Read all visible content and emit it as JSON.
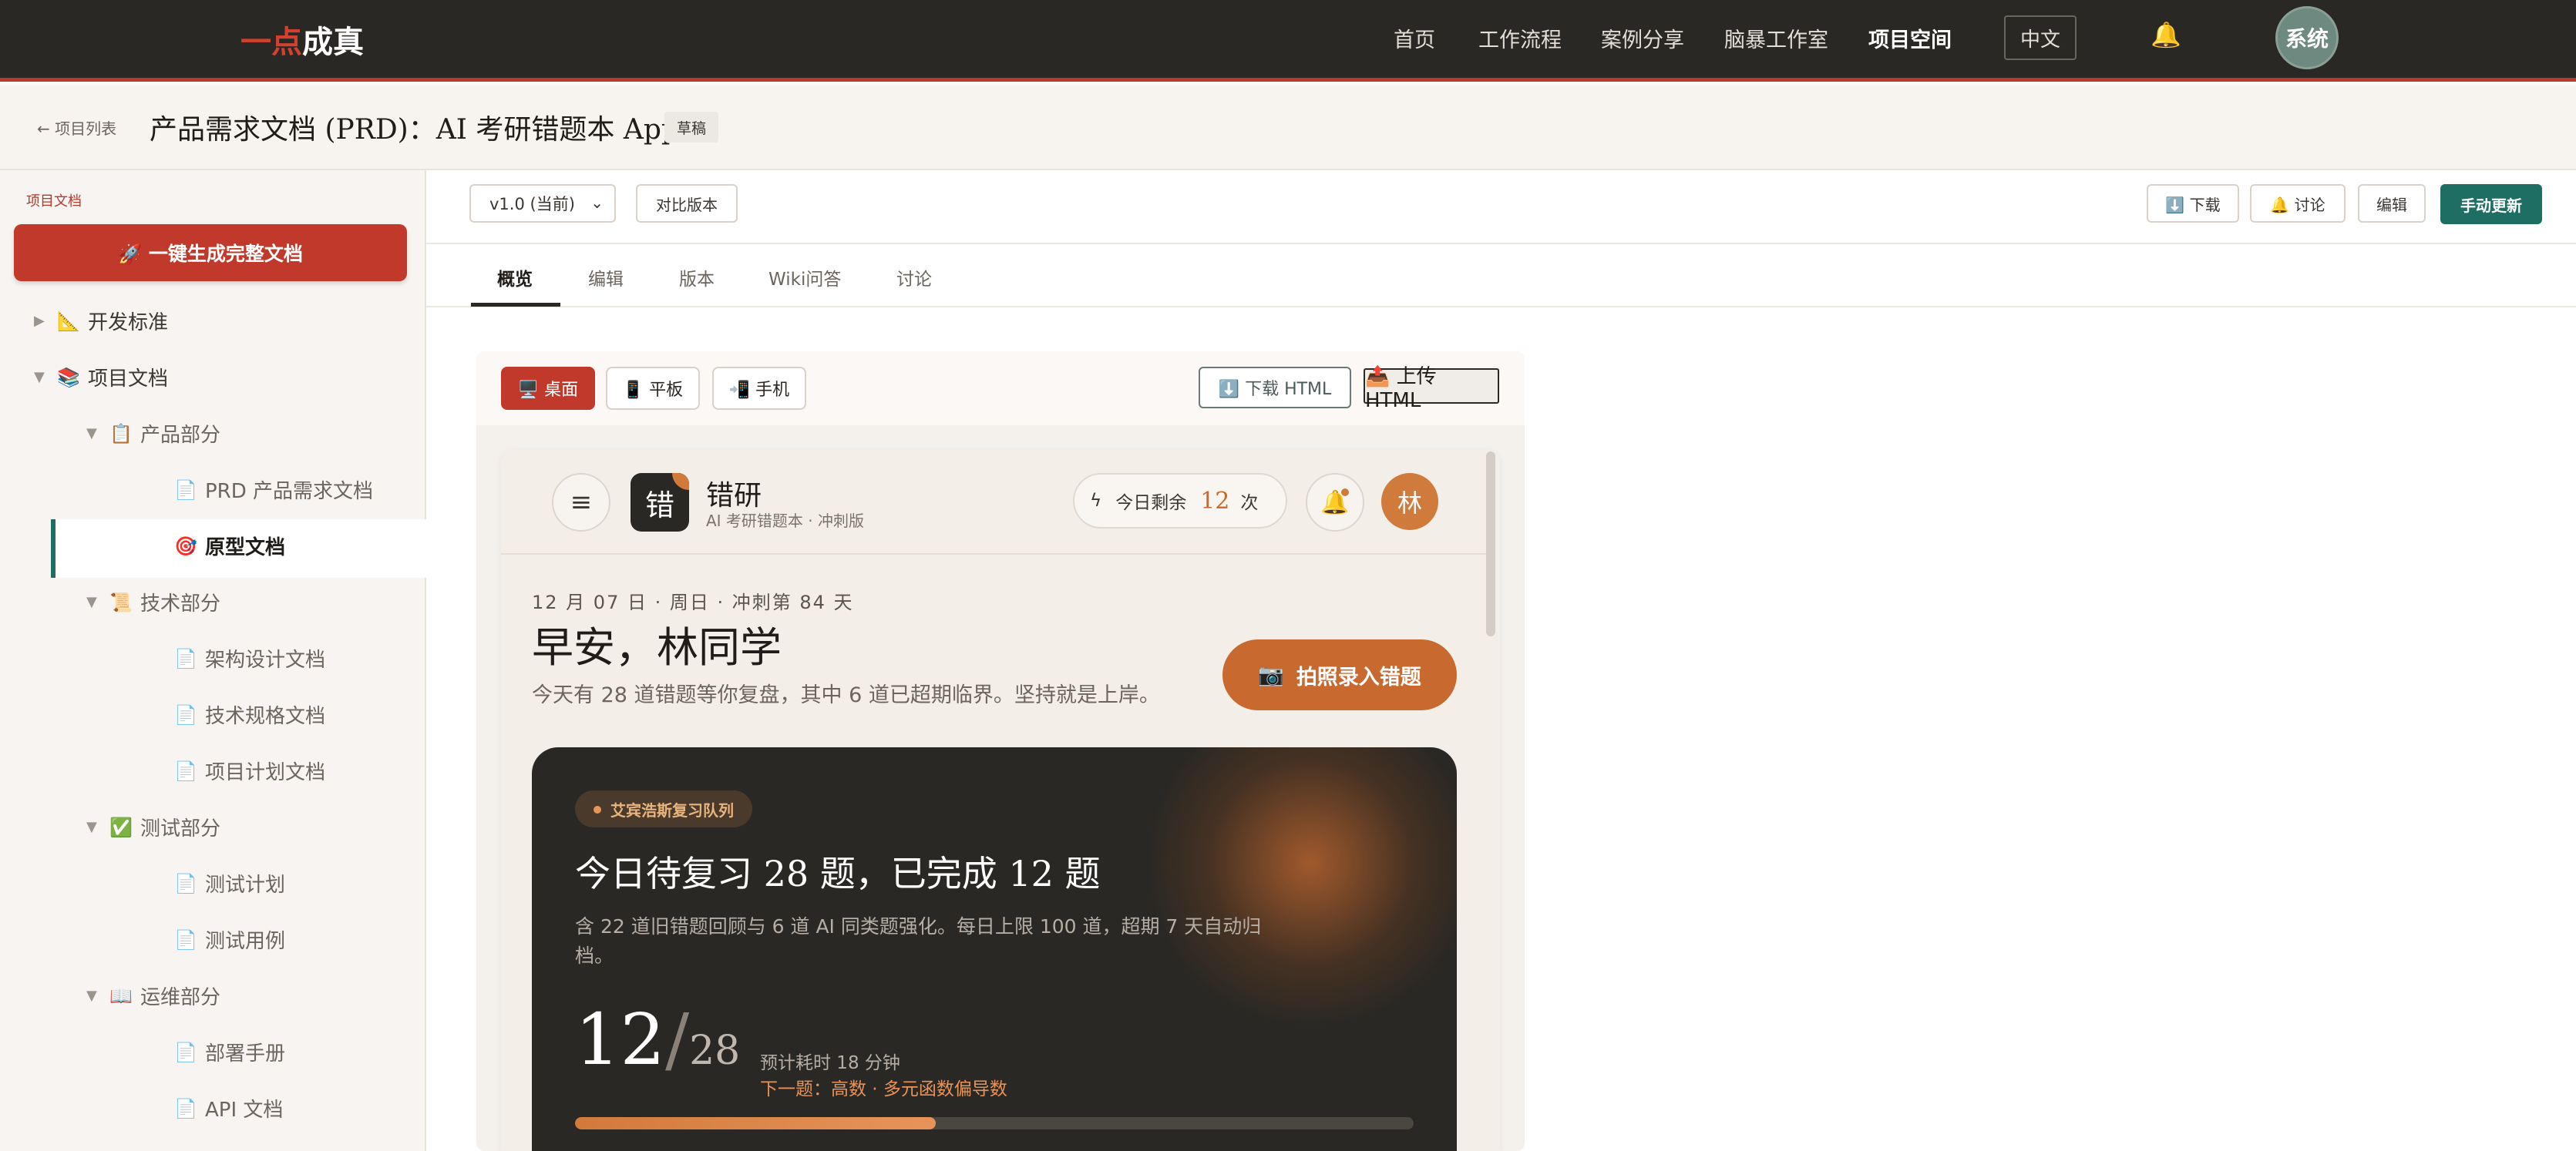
{
  "topbar": {
    "logo_part1": "一点",
    "logo_part2": "成真",
    "nav": [
      "首页",
      "工作流程",
      "案例分享",
      "脑暴工作室",
      "项目空间"
    ],
    "active_nav": "项目空间",
    "lang": "中文",
    "user": "系统"
  },
  "header": {
    "back": "← 项目列表",
    "title": "产品需求文档 (PRD)：AI 考研错题本 App",
    "badge": "草稿"
  },
  "sidebar": {
    "label": "项目文档",
    "generate_button": "🚀 一键生成完整文档",
    "items": [
      {
        "label": "开发标准",
        "icon": "📐",
        "arrow": "▶"
      },
      {
        "label": "项目文档",
        "icon": "📚",
        "arrow": "▼"
      },
      {
        "label": "产品部分",
        "icon": "📋",
        "arrow": "▼"
      },
      {
        "label": "PRD 产品需求文档",
        "icon": "📄"
      },
      {
        "label": "原型文档",
        "icon": "🎯"
      },
      {
        "label": "技术部分",
        "icon": "📜",
        "arrow": "▼"
      },
      {
        "label": "架构设计文档",
        "icon": "📄"
      },
      {
        "label": "技术规格文档",
        "icon": "📄"
      },
      {
        "label": "项目计划文档",
        "icon": "📄"
      },
      {
        "label": "测试部分",
        "icon": "✅",
        "arrow": "▼"
      },
      {
        "label": "测试计划",
        "icon": "📄"
      },
      {
        "label": "测试用例",
        "icon": "📄"
      },
      {
        "label": "运维部分",
        "icon": "📖",
        "arrow": "▼"
      },
      {
        "label": "部署手册",
        "icon": "📄"
      },
      {
        "label": "API 文档",
        "icon": "📄"
      }
    ]
  },
  "toolbar": {
    "version": "v1.0 (当前)",
    "compare": "对比版本",
    "download": "⬇️ 下载",
    "discuss": "🔔 讨论",
    "edit": "编辑",
    "manual_update": "手动更新"
  },
  "tabs": [
    "概览",
    "编辑",
    "版本",
    "Wiki问答",
    "讨论"
  ],
  "preview": {
    "devices": {
      "desktop": "🖥️ 桌面",
      "tablet": "📱 平板",
      "phone": "📲 手机"
    },
    "download_html": "⬇️ 下载 HTML",
    "upload_html": "📤 上传 HTML"
  },
  "app": {
    "logo_char": "错",
    "name": "错研",
    "subtitle": "AI 考研错题本 · 冲刺版",
    "quota_label": "今日剩余",
    "quota_value": "12",
    "quota_unit": "次",
    "avatar": "林",
    "date_line": "12 月 07 日 · 周日 · 冲刺第 84 天",
    "greeting": "早安，林同学",
    "greeting_sub": "今天有 28 道错题等你复盘，其中 6 道已超期临界。坚持就是上岸。",
    "camera_button": "拍照录入错题",
    "queue": {
      "badge": "艾宾浩斯复习队列",
      "title": "今日待复习 28 题，已完成 12 题",
      "desc": "含 22 道旧错题回顾与 6 道 AI 同类题强化。每日上限 100 道，超期 7 天自动归档。",
      "done": "12",
      "slash": "/",
      "total": "28",
      "eta": "预计耗时 18 分钟",
      "next": "下一题：高数 · 多元函数偏导数",
      "progress": 0.43
    }
  }
}
